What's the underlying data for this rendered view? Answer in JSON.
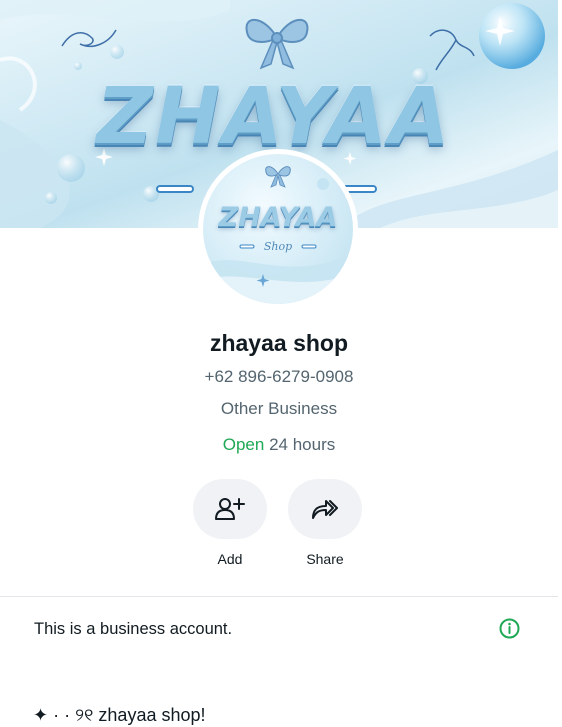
{
  "cover": {
    "banner_text": "ZHAYAA"
  },
  "avatar": {
    "logo_text": "ZHAYAA",
    "logo_sub": "Shop"
  },
  "profile": {
    "name": "zhayaa shop",
    "phone": "+62 896-6279-0908",
    "category": "Other Business",
    "hours_status": "Open",
    "hours_text": "24 hours"
  },
  "actions": [
    {
      "label": "Add",
      "icon": "add-contact-icon"
    },
    {
      "label": "Share",
      "icon": "share-forward-icon"
    }
  ],
  "business_notice": {
    "text": "This is a business account.",
    "icon": "info-icon"
  },
  "about": {
    "text": "✦ · · ୨୧ zhayaa shop!"
  },
  "colors": {
    "open_green": "#1fa855",
    "secondary_text": "#54656f",
    "button_bg": "#f0f2f5",
    "info_green": "#1fa855"
  }
}
